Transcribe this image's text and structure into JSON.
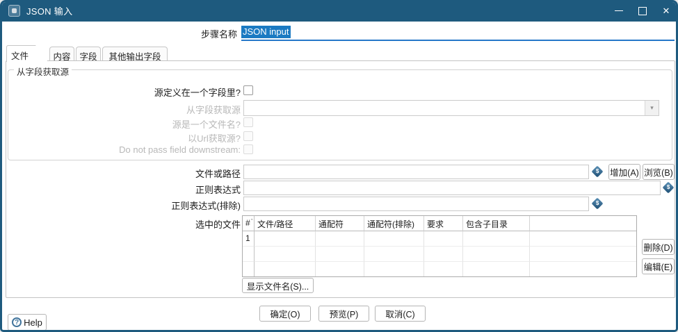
{
  "window": {
    "title": "JSON 输入"
  },
  "icons": {
    "app_icon": "json-input-step",
    "minimize_icon": "–",
    "maximize_icon": "□",
    "close_icon": "✕",
    "variable_icon": "$",
    "combo_arrow_icon": "▾",
    "help_icon": "?",
    "sort_indicator": "ˆ"
  },
  "step_name": {
    "label": "步骤名称",
    "value": "JSON input"
  },
  "tabs": [
    {
      "label": "文件"
    },
    {
      "label": "内容"
    },
    {
      "label": "字段"
    },
    {
      "label": "其他输出字段"
    }
  ],
  "source_group": {
    "legend": "从字段获取源",
    "source_in_field": {
      "label": "源定义在一个字段里?",
      "checked": false
    },
    "source_field": {
      "label": "从字段获取源",
      "value": ""
    },
    "source_is_filename": {
      "label": "源是一个文件名?",
      "checked": false
    },
    "read_as_url": {
      "label": "以Url获取源?",
      "checked": false
    },
    "no_pass_downstream": {
      "label": "Do not pass field downstream:",
      "checked": false
    }
  },
  "file_path": {
    "label": "文件或路径",
    "value": "",
    "add": "增加(A)",
    "browse": "浏览(B)"
  },
  "regex": {
    "label": "正则表达式",
    "value": ""
  },
  "regex_exclude": {
    "label": "正则表达式(排除)",
    "value": ""
  },
  "selected_files": {
    "label": "选中的文件",
    "columns": [
      "#",
      "文件/路径",
      "通配符",
      "通配符(排除)",
      "要求",
      "包含子目录"
    ],
    "rows": [
      {
        "num": "1"
      }
    ],
    "delete": "删除(D)",
    "edit": "编辑(E)"
  },
  "show_filenames": "显示文件名(S)...",
  "footer": {
    "ok": "确定(O)",
    "preview": "预览(P)",
    "cancel": "取消(C)",
    "help": "Help"
  }
}
